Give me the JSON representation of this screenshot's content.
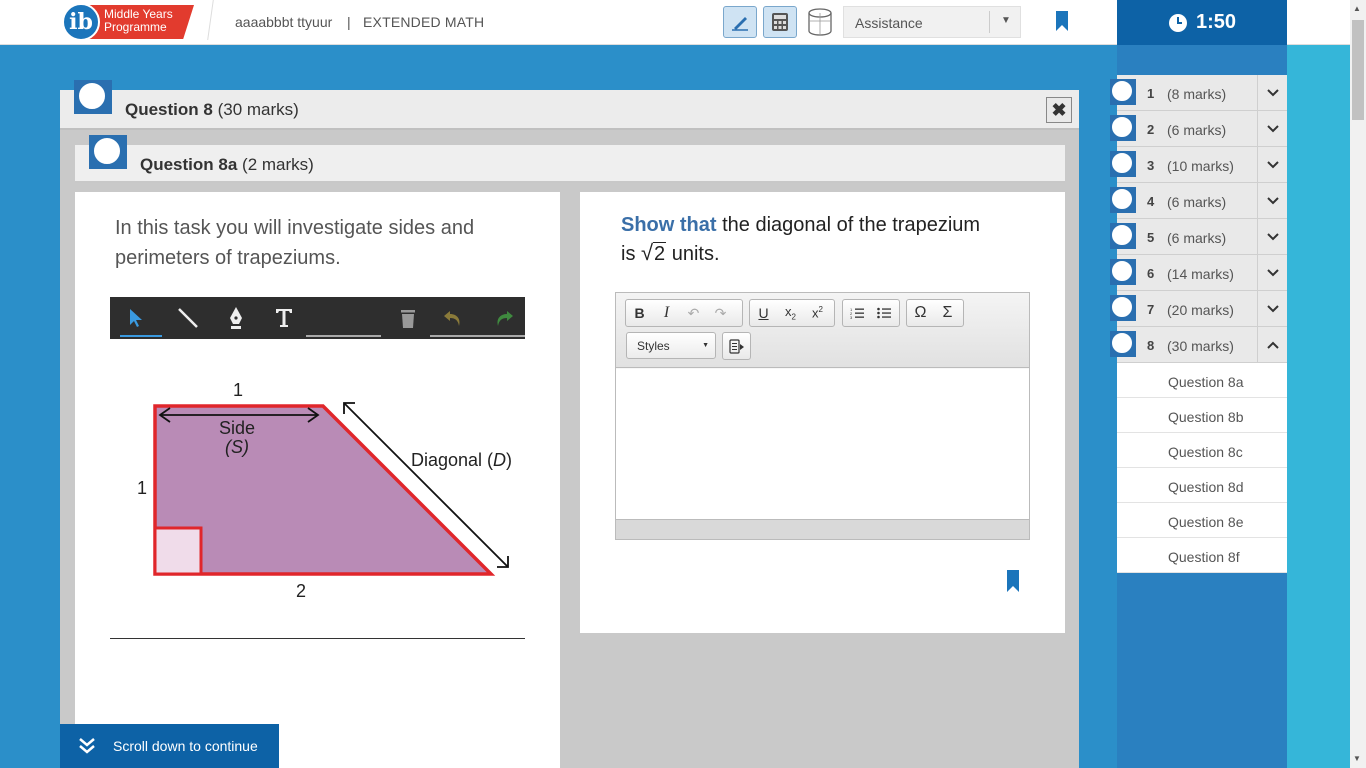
{
  "header": {
    "logo_letters": "ib",
    "logo_line1": "Middle Years",
    "logo_line2": "Programme",
    "user": "aaaabbbt ttyuur",
    "separator": "|",
    "subject": "EXTENDED MATH",
    "assistance_label": "Assistance",
    "timer": "1:50"
  },
  "question": {
    "title": "Question 8",
    "marks": "(30 marks)",
    "close_glyph": "✖",
    "sub_title": "Question 8a",
    "sub_marks": "(2 marks)",
    "intro": "In this task you will investigate sides and perimeters of trapeziums.",
    "prompt_cmd": "Show that",
    "prompt_text": "the diagonal of the trapezium",
    "prompt_is": "is",
    "prompt_radicand": "2",
    "prompt_units": "units."
  },
  "diagram": {
    "top_label": "1",
    "left_label": "1",
    "bottom_label": "2",
    "side_label_line1": "Side",
    "side_label_line2": "(S)",
    "diag_label_prefix": "Diagonal (",
    "diag_label_var": "D",
    "diag_label_suffix": ")",
    "fill_color": "#b98bb6",
    "edge_color": "#e0262b"
  },
  "editor": {
    "styles_label": "Styles"
  },
  "scroll_hint": "Scroll down to continue",
  "nav": {
    "items": [
      {
        "num": "1",
        "marks": "(8 marks)"
      },
      {
        "num": "2",
        "marks": "(6 marks)"
      },
      {
        "num": "3",
        "marks": "(10 marks)"
      },
      {
        "num": "4",
        "marks": "(6 marks)"
      },
      {
        "num": "5",
        "marks": "(6 marks)"
      },
      {
        "num": "6",
        "marks": "(14 marks)"
      },
      {
        "num": "7",
        "marks": "(20 marks)"
      },
      {
        "num": "8",
        "marks": "(30 marks)"
      }
    ],
    "sub_items": [
      "Question 8a",
      "Question 8b",
      "Question 8c",
      "Question 8d",
      "Question 8e",
      "Question 8f"
    ]
  },
  "colors": {
    "accent": "#0d62a6",
    "background": "#2b8fc9",
    "teal": "#35b6d9"
  }
}
